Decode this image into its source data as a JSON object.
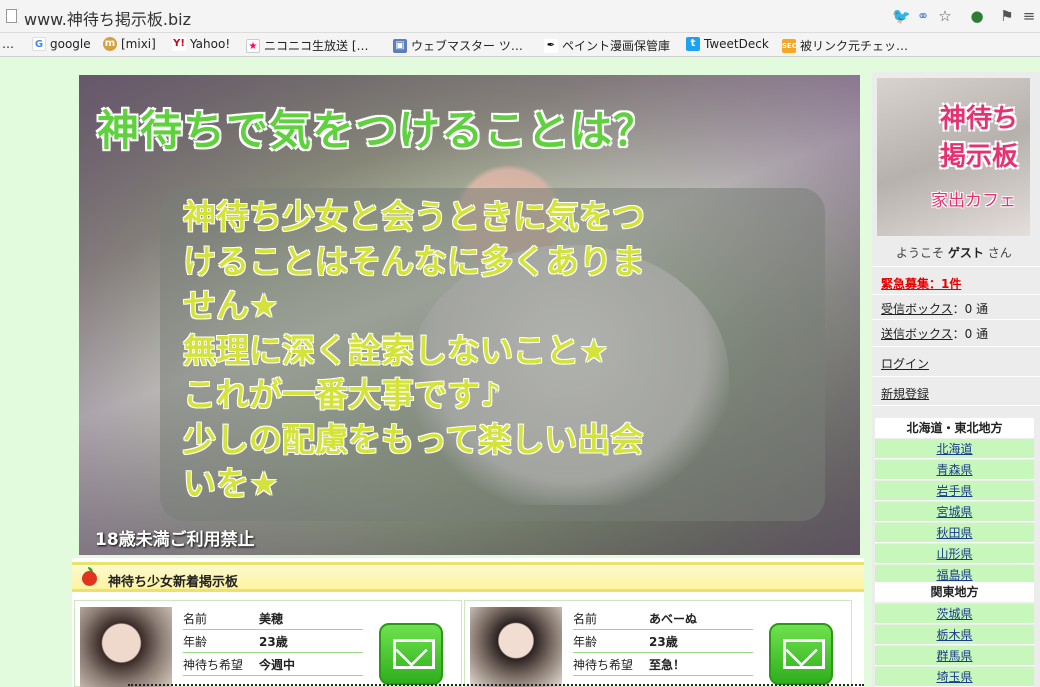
{
  "browser": {
    "url": "www.神待ち掲示板.biz",
    "bookmarks": [
      "google",
      "[mixi]",
      "Yahoo!",
      "ニコニコ生放送 […",
      "ウェブマスター ツ…",
      "ペイント漫画保管庫",
      "TweetDeck",
      "被リンク元チェッ…"
    ],
    "bookmark_icons": [
      "google-icon",
      "mixi-icon",
      "yahoo-icon",
      "nico-icon",
      "webmaster-icon",
      "paint-icon",
      "tweetdeck-icon",
      "seo-icon"
    ],
    "more": "…"
  },
  "hero": {
    "title": "神待ちで気をつけることは？",
    "lines": [
      "神待ち少女と会うときに気をつ",
      "けることはそんなに多くありま",
      "せん★",
      "無理に深く詮索しないこと★",
      "これが一番大事です♪",
      "少しの配慮をもって楽しい出会",
      "いを★"
    ],
    "note": "18歳未満ご利用禁止"
  },
  "board": {
    "title": "神待ち少女新着掲示板",
    "posts": [
      {
        "name_label": "名前",
        "name": "美穂",
        "age_label": "年齢",
        "age": "23歳",
        "wish_label": "神待ち希望",
        "wish": "今週中"
      },
      {
        "name_label": "名前",
        "name": "あべーぬ",
        "age_label": "年齢",
        "age": "23歳",
        "wish_label": "神待ち希望",
        "wish": "至急！"
      }
    ]
  },
  "sidebar": {
    "logo": {
      "line1": "神待ち",
      "line2": "掲示板",
      "line3": "家出カフェ"
    },
    "welcome_prefix": "ようこそ",
    "welcome_user": "ゲスト",
    "welcome_suffix": "さん",
    "urgent": "緊急募集：1件",
    "inbox_label": "受信ボックス",
    "inbox_count": "：0 通",
    "outbox_label": "送信ボックス",
    "outbox_count": "：0 通",
    "login": "ログイン",
    "register": "新規登録",
    "regions": [
      {
        "name": "北海道・東北地方",
        "prefs": [
          "北海道",
          "青森県",
          "岩手県",
          "宮城県",
          "秋田県",
          "山形県",
          "福島県"
        ]
      },
      {
        "name": "関東地方",
        "prefs": [
          "茨城県",
          "栃木県",
          "群馬県",
          "埼玉県"
        ]
      }
    ]
  }
}
